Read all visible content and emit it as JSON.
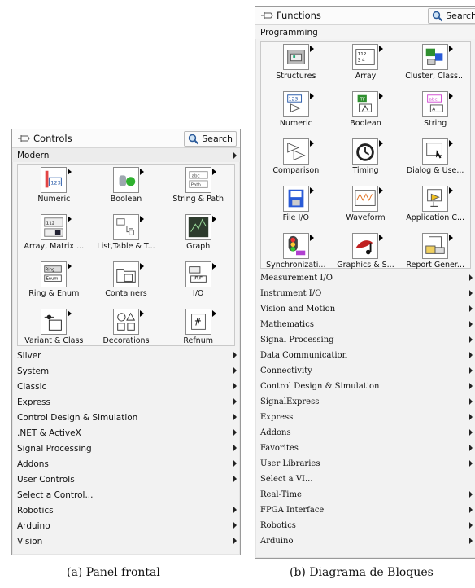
{
  "controls": {
    "title": "Controls",
    "search_label": "Search",
    "section": "Modern",
    "icons": [
      {
        "label": "Numeric",
        "icon": "numeric-control-icon"
      },
      {
        "label": "Boolean",
        "icon": "boolean-control-icon"
      },
      {
        "label": "String & Path",
        "icon": "string-path-icon"
      },
      {
        "label": "Array, Matrix ...",
        "icon": "array-matrix-icon"
      },
      {
        "label": "List,Table & T...",
        "icon": "list-table-icon"
      },
      {
        "label": "Graph",
        "icon": "graph-icon"
      },
      {
        "label": "Ring & Enum",
        "icon": "ring-enum-icon"
      },
      {
        "label": "Containers",
        "icon": "containers-icon"
      },
      {
        "label": "I/O",
        "icon": "io-icon"
      },
      {
        "label": "Variant & Class",
        "icon": "variant-class-icon"
      },
      {
        "label": "Decorations",
        "icon": "decorations-icon"
      },
      {
        "label": "Refnum",
        "icon": "refnum-icon"
      }
    ],
    "categories": [
      {
        "label": "Silver",
        "arrow": true
      },
      {
        "label": "System",
        "arrow": true
      },
      {
        "label": "Classic",
        "arrow": true
      },
      {
        "label": "Express",
        "arrow": true
      },
      {
        "label": "Control Design & Simulation",
        "arrow": true
      },
      {
        "label": ".NET & ActiveX",
        "arrow": true
      },
      {
        "label": "Signal Processing",
        "arrow": true
      },
      {
        "label": "Addons",
        "arrow": true
      },
      {
        "label": "User Controls",
        "arrow": true
      },
      {
        "label": "Select a Control...",
        "arrow": false
      },
      {
        "label": "Robotics",
        "arrow": true
      },
      {
        "label": "Arduino",
        "arrow": true
      },
      {
        "label": "Vision",
        "arrow": true
      }
    ]
  },
  "functions": {
    "title": "Functions",
    "search_label": "Search",
    "section": "Programming",
    "icons": [
      {
        "label": "Structures",
        "icon": "structures-icon"
      },
      {
        "label": "Array",
        "icon": "array-icon"
      },
      {
        "label": "Cluster, Class...",
        "icon": "cluster-class-icon"
      },
      {
        "label": "Numeric",
        "icon": "numeric-function-icon"
      },
      {
        "label": "Boolean",
        "icon": "boolean-function-icon"
      },
      {
        "label": "String",
        "icon": "string-icon"
      },
      {
        "label": "Comparison",
        "icon": "comparison-icon"
      },
      {
        "label": "Timing",
        "icon": "timing-icon"
      },
      {
        "label": "Dialog & Use...",
        "icon": "dialog-icon"
      },
      {
        "label": "File I/O",
        "icon": "file-io-icon"
      },
      {
        "label": "Waveform",
        "icon": "waveform-icon"
      },
      {
        "label": "Application C...",
        "icon": "application-control-icon"
      },
      {
        "label": "Synchronizati...",
        "icon": "synchronization-icon"
      },
      {
        "label": "Graphics & S...",
        "icon": "graphics-sound-icon"
      },
      {
        "label": "Report Gener...",
        "icon": "report-generation-icon"
      }
    ],
    "categories": [
      {
        "label": "Measurement I/O",
        "arrow": true
      },
      {
        "label": "Instrument I/O",
        "arrow": true
      },
      {
        "label": "Vision and Motion",
        "arrow": true
      },
      {
        "label": "Mathematics",
        "arrow": true
      },
      {
        "label": "Signal Processing",
        "arrow": true
      },
      {
        "label": "Data Communication",
        "arrow": true
      },
      {
        "label": "Connectivity",
        "arrow": true
      },
      {
        "label": "Control Design & Simulation",
        "arrow": true
      },
      {
        "label": "SignalExpress",
        "arrow": true
      },
      {
        "label": "Express",
        "arrow": true
      },
      {
        "label": "Addons",
        "arrow": true
      },
      {
        "label": "Favorites",
        "arrow": true
      },
      {
        "label": "User Libraries",
        "arrow": true
      },
      {
        "label": "Select a VI...",
        "arrow": false
      },
      {
        "label": "Real-Time",
        "arrow": true
      },
      {
        "label": "FPGA Interface",
        "arrow": true
      },
      {
        "label": "Robotics",
        "arrow": true
      },
      {
        "label": "Arduino",
        "arrow": true
      }
    ]
  },
  "captions": {
    "left": "(a)  Panel frontal",
    "right": "(b)  Diagrama de Bloques"
  }
}
